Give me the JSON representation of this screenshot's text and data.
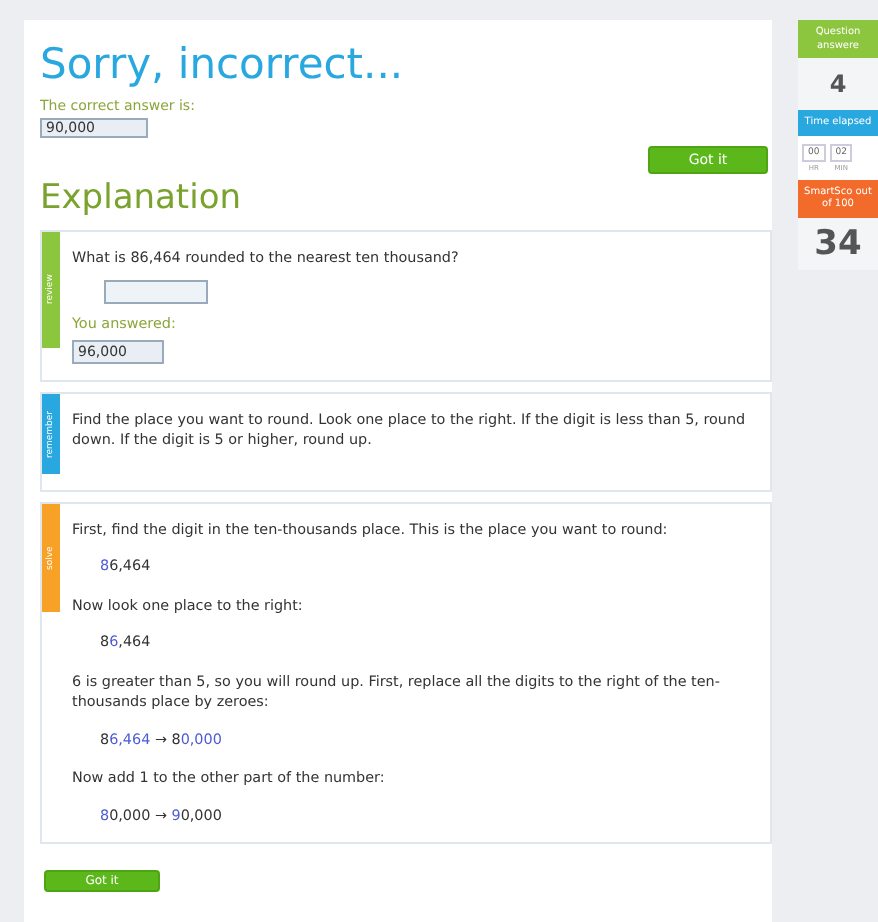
{
  "header": {
    "title": "Sorry, incorrect...",
    "correct_label": "The correct answer is:",
    "correct_value": "90,000",
    "button": "Got it"
  },
  "explanation": {
    "heading": "Explanation"
  },
  "cards": [
    {
      "kind": "review",
      "tag": "review",
      "color": "#8cc63f",
      "question": "What is 86,464 rounded to the nearest ten thousand?",
      "answered_label": "You answered:",
      "answered_value": "96,000"
    },
    {
      "kind": "remember",
      "tag": "remember",
      "color": "#29a8e0",
      "text": "Find the place you want to round. Look one place to the right. If the digit is less than 5, round down. If the digit is 5 or higher, round up."
    },
    {
      "kind": "solve",
      "tag": "solve",
      "color": "#f7a226",
      "steps": [
        {
          "kind": "text",
          "text": "First, find the digit in the ten-thousands place. This is the place you want to round:"
        },
        {
          "kind": "math",
          "parts": [
            {
              "text": "8",
              "highlight": true
            },
            {
              "text": "6,464",
              "highlight": false
            }
          ]
        },
        {
          "kind": "text",
          "text": "Now look one place to the right:"
        },
        {
          "kind": "math",
          "parts": [
            {
              "text": "8",
              "highlight": false
            },
            {
              "text": "6",
              "highlight": true
            },
            {
              "text": ",464",
              "highlight": false
            }
          ]
        },
        {
          "kind": "text",
          "text": "6 is greater than 5, so you will round up. First, replace all the digits to the right of the ten-thousands place by zeroes:"
        },
        {
          "kind": "math",
          "parts": [
            {
              "text": "8",
              "highlight": false
            },
            {
              "text": "6,464",
              "highlight": true
            },
            {
              "text": " → ",
              "highlight": false
            },
            {
              "text": "8",
              "highlight": false
            },
            {
              "text": "0,000",
              "highlight": true
            }
          ]
        },
        {
          "kind": "text",
          "text": "Now add 1 to the other part of the number:"
        },
        {
          "kind": "math",
          "parts": [
            {
              "text": "8",
              "highlight": true
            },
            {
              "text": "0,000 → ",
              "highlight": false
            },
            {
              "text": "9",
              "highlight": true
            },
            {
              "text": "0,000",
              "highlight": false
            }
          ]
        }
      ]
    }
  ],
  "bottom_button": "Got it",
  "sidebar": [
    {
      "kind": "header",
      "label": "Question answere",
      "color": "#8cc63f"
    },
    {
      "kind": "value",
      "value": "4"
    },
    {
      "kind": "header",
      "label": "Time elapsed",
      "color": "#29a8e0"
    },
    {
      "kind": "timer",
      "fields": [
        {
          "value": "00",
          "unit": "HR"
        },
        {
          "value": "02",
          "unit": "MIN"
        }
      ]
    },
    {
      "kind": "header",
      "label": "SmartSco out of 100",
      "color": "#f26b2a"
    },
    {
      "kind": "value",
      "value": "34"
    }
  ]
}
